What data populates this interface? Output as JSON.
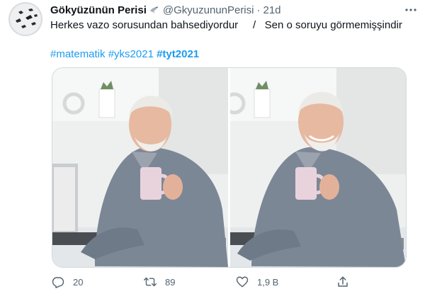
{
  "user": {
    "display_name": "Gökyüzünün Perisi",
    "handle": "@GkyuzununPerisi",
    "separator": "·",
    "time": "21d"
  },
  "tweet": {
    "text": "Herkes vazo sorusundan bahsediyordur     /   Sen o soruyu görmemişşindir",
    "hashtags": [
      "#matematik",
      "#yks2021",
      "#tyt2021"
    ]
  },
  "actions": {
    "reply_count": "20",
    "retweet_count": "89",
    "like_count": "1,9 B"
  },
  "colors": {
    "link": "#1d9bf0",
    "secondary_text": "#536471",
    "primary_text": "#0f1419",
    "border": "#cfd9de"
  },
  "icons": [
    "dove-emoji-icon",
    "more-icon",
    "reply-icon",
    "retweet-icon",
    "like-icon",
    "share-icon"
  ]
}
